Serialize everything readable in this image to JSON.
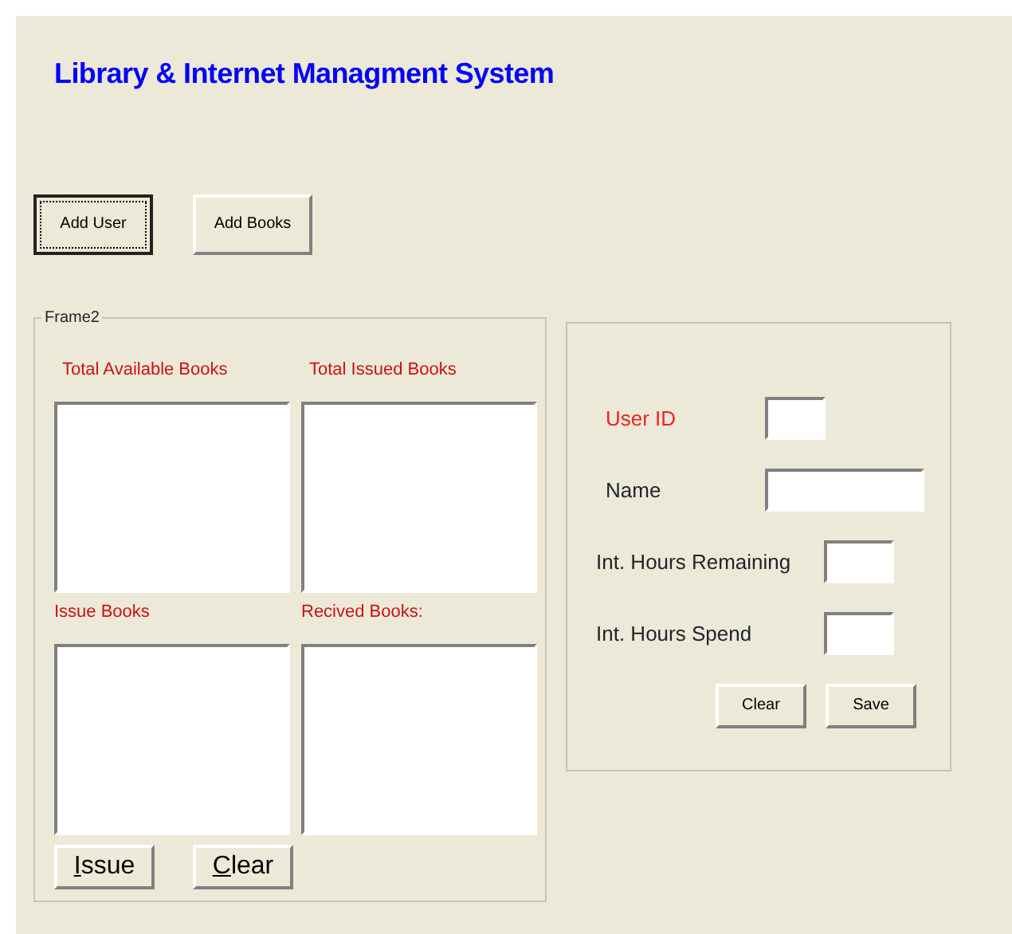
{
  "title": "Library & Internet Managment System",
  "top_buttons": [
    {
      "label": "Add User",
      "focused": true
    },
    {
      "label": "Add Books",
      "focused": false
    }
  ],
  "frame": {
    "caption": "Frame2",
    "lists": [
      {
        "label": "Total Available Books"
      },
      {
        "label": "Total Issued Books"
      },
      {
        "label": "Issue Books"
      },
      {
        "label": "Recived Books:"
      }
    ],
    "buttons": [
      {
        "label": "Issue",
        "mnemonic": true
      },
      {
        "label": "Clear",
        "mnemonic": true
      }
    ]
  },
  "user_panel": {
    "fields": [
      {
        "label": "User ID",
        "highlighted": true,
        "kind": "short"
      },
      {
        "label": "Name",
        "highlighted": false,
        "kind": "wide"
      },
      {
        "label": "Int. Hours Remaining",
        "highlighted": false,
        "kind": "short"
      },
      {
        "label": "Int. Hours Spend",
        "highlighted": false,
        "kind": "short"
      }
    ],
    "buttons": [
      {
        "label": "Clear"
      },
      {
        "label": "Save"
      }
    ]
  }
}
